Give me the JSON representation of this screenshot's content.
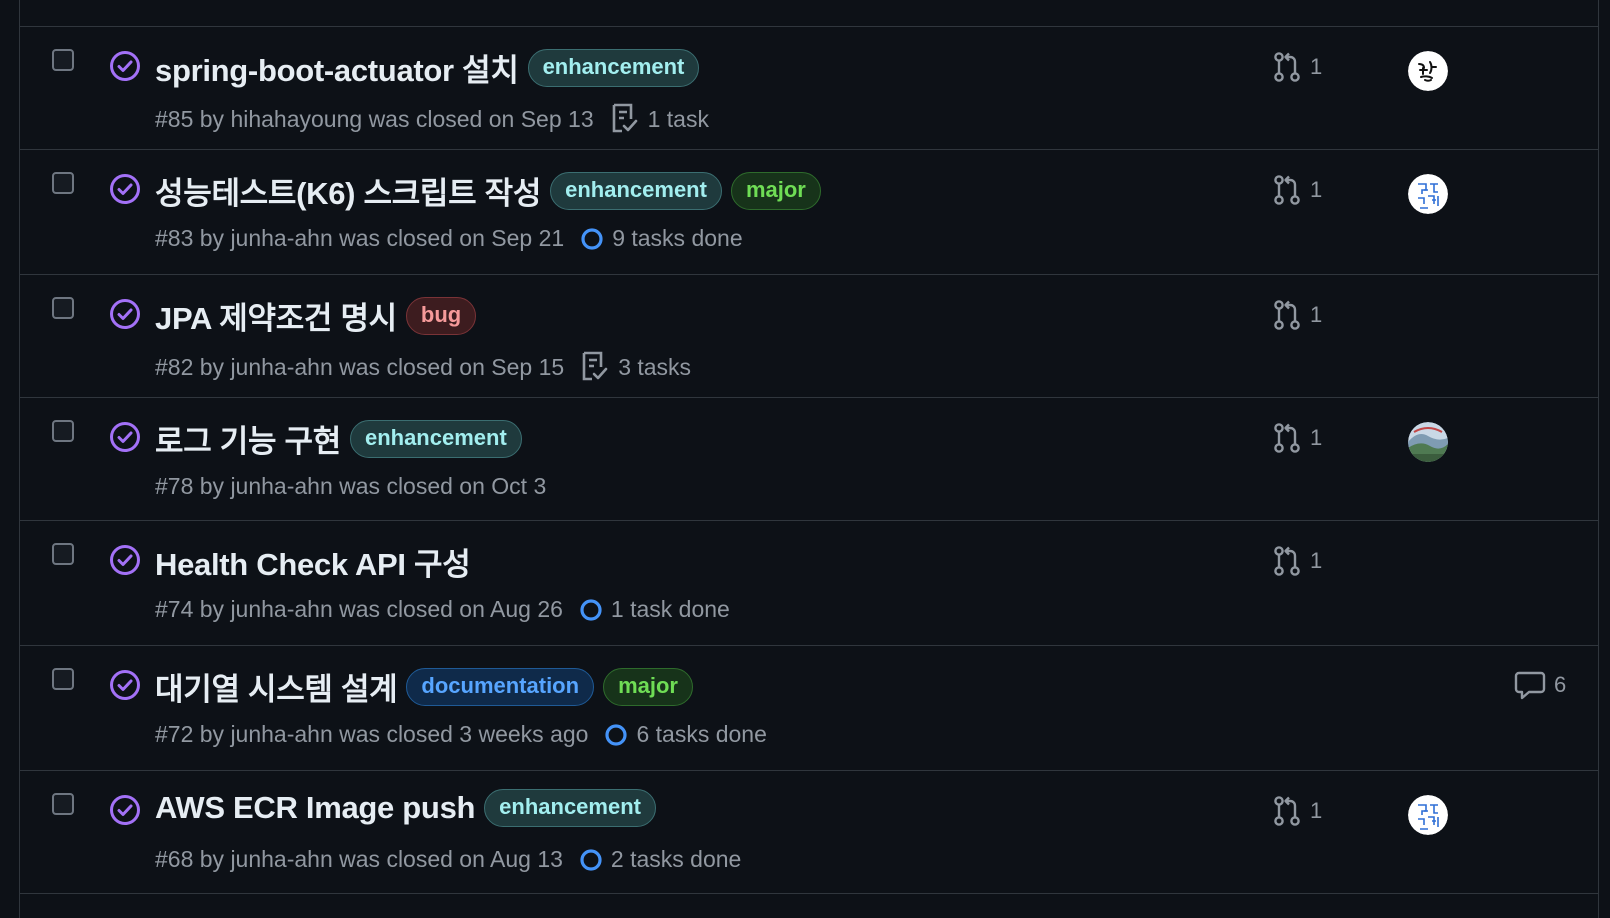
{
  "colors": {
    "background": "#0d1117",
    "border": "#30363d",
    "closed_purple": "#a371f7",
    "progress_blue": "#4493f8",
    "muted_text": "#9198a1"
  },
  "issues": [
    {
      "title": "spring-boot-actuator 설치",
      "labels": [
        {
          "name": "enhancement",
          "kind": "enhancement"
        }
      ],
      "meta": "#85 by hihahayoung was closed on Sep 13",
      "tasks": {
        "text": "1 task",
        "icon": "tasklist-icon"
      },
      "linked_prs": "1",
      "avatar": "avatar-handwriting",
      "comments": null
    },
    {
      "title": "성능테스트(K6) 스크립트 작성",
      "labels": [
        {
          "name": "enhancement",
          "kind": "enhancement"
        },
        {
          "name": "major",
          "kind": "major"
        }
      ],
      "meta": "#83 by junha-ahn was closed on Sep 21",
      "tasks": {
        "text": "9 tasks done",
        "icon": "progress-circle-icon"
      },
      "linked_prs": "1",
      "avatar": "avatar-junha-pattern",
      "comments": null
    },
    {
      "title": "JPA 제약조건 명시",
      "labels": [
        {
          "name": "bug",
          "kind": "bug"
        }
      ],
      "meta": "#82 by junha-ahn was closed on Sep 15",
      "tasks": {
        "text": "3 tasks",
        "icon": "tasklist-icon"
      },
      "linked_prs": "1",
      "avatar": null,
      "comments": null
    },
    {
      "title": "로그 기능 구현",
      "labels": [
        {
          "name": "enhancement",
          "kind": "enhancement"
        }
      ],
      "meta": "#78 by junha-ahn was closed on Oct 3",
      "tasks": null,
      "linked_prs": "1",
      "avatar": "avatar-landscape",
      "comments": null
    },
    {
      "title": "Health Check API 구성",
      "labels": [],
      "meta": "#74 by junha-ahn was closed on Aug 26",
      "tasks": {
        "text": "1 task done",
        "icon": "progress-circle-icon"
      },
      "linked_prs": "1",
      "avatar": null,
      "comments": null
    },
    {
      "title": "대기열 시스템 설계",
      "labels": [
        {
          "name": "documentation",
          "kind": "documentation"
        },
        {
          "name": "major",
          "kind": "major"
        }
      ],
      "meta": "#72 by junha-ahn was closed 3 weeks ago",
      "tasks": {
        "text": "6 tasks done",
        "icon": "progress-circle-icon"
      },
      "linked_prs": null,
      "avatar": null,
      "comments": "6"
    },
    {
      "title": "AWS ECR Image push",
      "labels": [
        {
          "name": "enhancement",
          "kind": "enhancement"
        }
      ],
      "meta": "#68 by junha-ahn was closed on Aug 13",
      "tasks": {
        "text": "2 tasks done",
        "icon": "progress-circle-icon"
      },
      "linked_prs": "1",
      "avatar": "avatar-junha-pattern",
      "comments": null
    }
  ],
  "label_styles": {
    "enhancement": {
      "fg": "#a2eeef",
      "bg": "#1f3a3d",
      "border": "#3b6e71"
    },
    "major": {
      "fg": "#6fdd55",
      "bg": "#17331a",
      "border": "#2e6b2c"
    },
    "bug": {
      "fg": "#f69a9a",
      "bg": "#3d1c1f",
      "border": "#7a3337"
    },
    "documentation": {
      "fg": "#57a5ff",
      "bg": "#0f2a4a",
      "border": "#1f5a96"
    }
  }
}
